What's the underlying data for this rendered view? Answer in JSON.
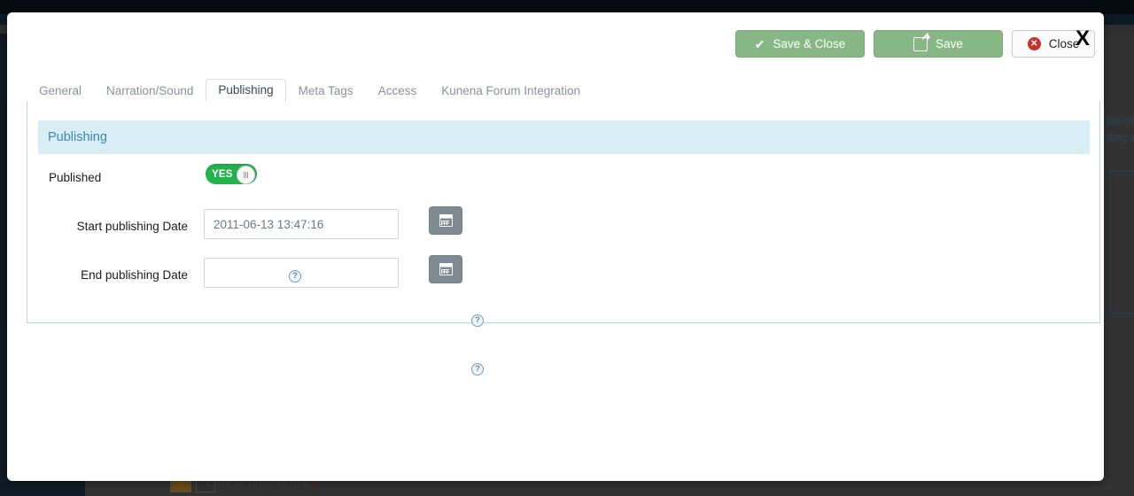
{
  "background": {
    "cutoff_text_line1": "ble of",
    "cutoff_text_line2": "ding a",
    "bottom_label": "Date & Time format",
    "bottom_close": "x"
  },
  "modal": {
    "close_x": "X",
    "toolbar": {
      "save_close_label": "Save & Close",
      "save_close_icon": "check-icon",
      "save_label": "Save",
      "save_icon": "pencil-square-icon",
      "close_label": "Close",
      "close_icon": "red-circle-x-icon"
    },
    "tabs": [
      {
        "label": "General",
        "active": false
      },
      {
        "label": "Narration/Sound",
        "active": false
      },
      {
        "label": "Publishing",
        "active": true
      },
      {
        "label": "Meta Tags",
        "active": false
      },
      {
        "label": "Access",
        "active": false
      },
      {
        "label": "Kunena Forum Integration",
        "active": false
      }
    ],
    "panel": {
      "legend": "Publishing",
      "fields": {
        "published": {
          "label": "Published",
          "toggle_value": "YES",
          "help_icon": "question-mark-icon"
        },
        "start_date": {
          "label": "Start publishing Date",
          "value": "2011-06-13 13:47:16",
          "placeholder": "",
          "calendar_icon": "calendar-icon",
          "help_icon": "question-mark-icon"
        },
        "end_date": {
          "label": "End publishing Date",
          "value": "",
          "placeholder": "",
          "calendar_icon": "calendar-icon",
          "help_icon": "question-mark-icon"
        }
      }
    }
  },
  "colors": {
    "toggle_on": "#22b24c",
    "button_green": "#86b784",
    "legend_bg": "#d9edf7",
    "legend_text": "#3a87ad",
    "calendar_button": "#7d8a91",
    "close_icon_red": "#c9302c"
  }
}
